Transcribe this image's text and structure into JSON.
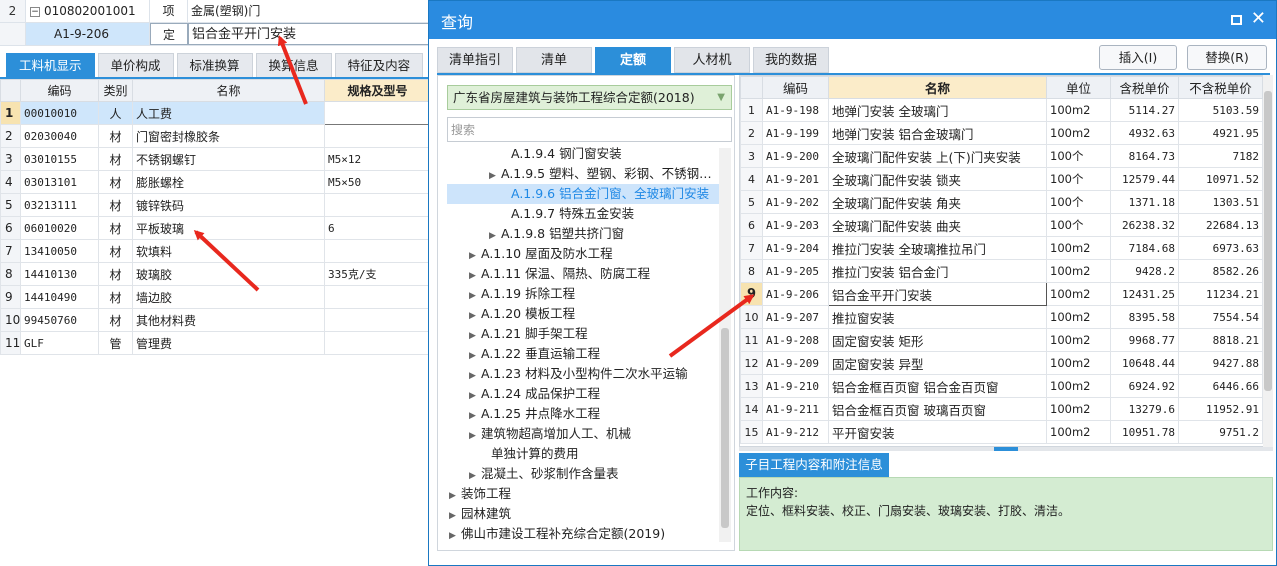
{
  "background": {
    "rows_top": [
      {
        "num": "2",
        "code": "010802001001",
        "type": "项",
        "name": "金属(塑钢)门",
        "expand": "−"
      },
      {
        "num": "",
        "code": "A1-9-206",
        "type": "定",
        "name": "铝合金平开门安装"
      }
    ],
    "tabs": [
      "工料机显示",
      "单价构成",
      "标准换算",
      "换算信息",
      "特征及内容"
    ],
    "table": {
      "headers": [
        "",
        "编码",
        "类别",
        "名称",
        "规格及型号"
      ],
      "rows": [
        {
          "n": "1",
          "code": "00010010",
          "cat": "人",
          "name": "人工费",
          "spec": ""
        },
        {
          "n": "2",
          "code": "02030040",
          "cat": "材",
          "name": "门窗密封橡胶条",
          "spec": ""
        },
        {
          "n": "3",
          "code": "03010155",
          "cat": "材",
          "name": "不锈钢螺钉",
          "spec": "M5×12"
        },
        {
          "n": "4",
          "code": "03013101",
          "cat": "材",
          "name": "膨胀螺栓",
          "spec": "M5×50"
        },
        {
          "n": "5",
          "code": "03213111",
          "cat": "材",
          "name": "镀锌铁码",
          "spec": ""
        },
        {
          "n": "6",
          "code": "06010020",
          "cat": "材",
          "name": "平板玻璃",
          "spec": "6"
        },
        {
          "n": "7",
          "code": "13410050",
          "cat": "材",
          "name": "软填料",
          "spec": ""
        },
        {
          "n": "8",
          "code": "14410130",
          "cat": "材",
          "name": "玻璃胶",
          "spec": "335克/支"
        },
        {
          "n": "9",
          "code": "14410490",
          "cat": "材",
          "name": "墙边胶",
          "spec": ""
        },
        {
          "n": "10",
          "code": "99450760",
          "cat": "材",
          "name": "其他材料费",
          "spec": ""
        },
        {
          "n": "11",
          "code": "GLF",
          "cat": "管",
          "name": "管理费",
          "spec": ""
        }
      ]
    }
  },
  "dialog": {
    "title": "查询",
    "close_glyph": "✕",
    "tabs": [
      "清单指引",
      "清单",
      "定额",
      "人材机",
      "我的数据"
    ],
    "buttons": {
      "insert": "插入(I)",
      "replace": "替换(R)"
    },
    "quota_library": "广东省房屋建筑与装饰工程综合定额(2018)",
    "search_placeholder": "搜索",
    "tree": [
      {
        "label": "A.1.9.4 钢门窗安装",
        "expand": ""
      },
      {
        "label": "A.1.9.5 塑料、塑钢、彩钢、不锈钢…",
        "expand": "▶"
      },
      {
        "label": "A.1.9.6 铝合金门窗、全玻璃门安装",
        "expand": ""
      },
      {
        "label": "A.1.9.7 特殊五金安装",
        "expand": ""
      },
      {
        "label": "A.1.9.8 铝塑共挤门窗",
        "expand": "▶"
      },
      {
        "label": "A.1.10 屋面及防水工程",
        "expand": "▶"
      },
      {
        "label": "A.1.11 保温、隔热、防腐工程",
        "expand": "▶"
      },
      {
        "label": "A.1.19 拆除工程",
        "expand": "▶"
      },
      {
        "label": "A.1.20 模板工程",
        "expand": "▶"
      },
      {
        "label": "A.1.21 脚手架工程",
        "expand": "▶"
      },
      {
        "label": "A.1.22 垂直运输工程",
        "expand": "▶"
      },
      {
        "label": "A.1.23 材料及小型构件二次水平运输",
        "expand": "▶"
      },
      {
        "label": "A.1.24 成品保护工程",
        "expand": "▶"
      },
      {
        "label": "A.1.25 井点降水工程",
        "expand": "▶"
      },
      {
        "label": "建筑物超高增加人工、机械",
        "expand": "▶"
      },
      {
        "label": "单独计算的费用",
        "expand": ""
      },
      {
        "label": "混凝土、砂浆制作含量表",
        "expand": "▶"
      },
      {
        "label": "装饰工程",
        "expand": "▶"
      },
      {
        "label": "园林建筑",
        "expand": "▶"
      },
      {
        "label": "佛山市建设工程补充综合定额(2019)",
        "expand": "▶"
      }
    ],
    "grid": {
      "headers": [
        "",
        "编码",
        "名称",
        "单位",
        "含税单价",
        "不含税单价"
      ],
      "rows": [
        {
          "n": "1",
          "code": "A1-9-198",
          "name": "地弹门安装 全玻璃门",
          "unit": "100m2",
          "price_tax": "5114.27",
          "price_notax": "5103.59"
        },
        {
          "n": "2",
          "code": "A1-9-199",
          "name": "地弹门安装 铝合金玻璃门",
          "unit": "100m2",
          "price_tax": "4932.63",
          "price_notax": "4921.95"
        },
        {
          "n": "3",
          "code": "A1-9-200",
          "name": "全玻璃门配件安装 上(下)门夹安装",
          "unit": "100个",
          "price_tax": "8164.73",
          "price_notax": "7182"
        },
        {
          "n": "4",
          "code": "A1-9-201",
          "name": "全玻璃门配件安装 锁夹",
          "unit": "100个",
          "price_tax": "12579.44",
          "price_notax": "10971.52"
        },
        {
          "n": "5",
          "code": "A1-9-202",
          "name": "全玻璃门配件安装 角夹",
          "unit": "100个",
          "price_tax": "1371.18",
          "price_notax": "1303.51"
        },
        {
          "n": "6",
          "code": "A1-9-203",
          "name": "全玻璃门配件安装 曲夹",
          "unit": "100个",
          "price_tax": "26238.32",
          "price_notax": "22684.13"
        },
        {
          "n": "7",
          "code": "A1-9-204",
          "name": "推拉门安装 全玻璃推拉吊门",
          "unit": "100m2",
          "price_tax": "7184.68",
          "price_notax": "6973.63"
        },
        {
          "n": "8",
          "code": "A1-9-205",
          "name": "推拉门安装 铝合金门",
          "unit": "100m2",
          "price_tax": "9428.2",
          "price_notax": "8582.26"
        },
        {
          "n": "9",
          "code": "A1-9-206",
          "name": "铝合金平开门安装",
          "unit": "100m2",
          "price_tax": "12431.25",
          "price_notax": "11234.21"
        },
        {
          "n": "10",
          "code": "A1-9-207",
          "name": "推拉窗安装",
          "unit": "100m2",
          "price_tax": "8395.58",
          "price_notax": "7554.54"
        },
        {
          "n": "11",
          "code": "A1-9-208",
          "name": "固定窗安装 矩形",
          "unit": "100m2",
          "price_tax": "9968.77",
          "price_notax": "8818.21"
        },
        {
          "n": "12",
          "code": "A1-9-209",
          "name": "固定窗安装 异型",
          "unit": "100m2",
          "price_tax": "10648.44",
          "price_notax": "9427.88"
        },
        {
          "n": "13",
          "code": "A1-9-210",
          "name": "铝合金框百页窗 铝合金百页窗",
          "unit": "100m2",
          "price_tax": "6924.92",
          "price_notax": "6446.66"
        },
        {
          "n": "14",
          "code": "A1-9-211",
          "name": "铝合金框百页窗 玻璃百页窗",
          "unit": "100m2",
          "price_tax": "13279.6",
          "price_notax": "11952.91"
        },
        {
          "n": "15",
          "code": "A1-9-212",
          "name": "平开窗安装",
          "unit": "100m2",
          "price_tax": "10951.78",
          "price_notax": "9751.2"
        }
      ]
    },
    "info_tab": "子目工程内容和附注信息",
    "info_title": "工作内容:",
    "info_text": "定位、框料安装、校正、门扇安装、玻璃安装、打胶、清洁。"
  },
  "colors": {
    "accent": "#2c8fd9",
    "title_bar": "#2a8be0",
    "selection": "#cfe6fb",
    "arrow": "#e8281e",
    "info_bg": "#d4ecd2"
  }
}
